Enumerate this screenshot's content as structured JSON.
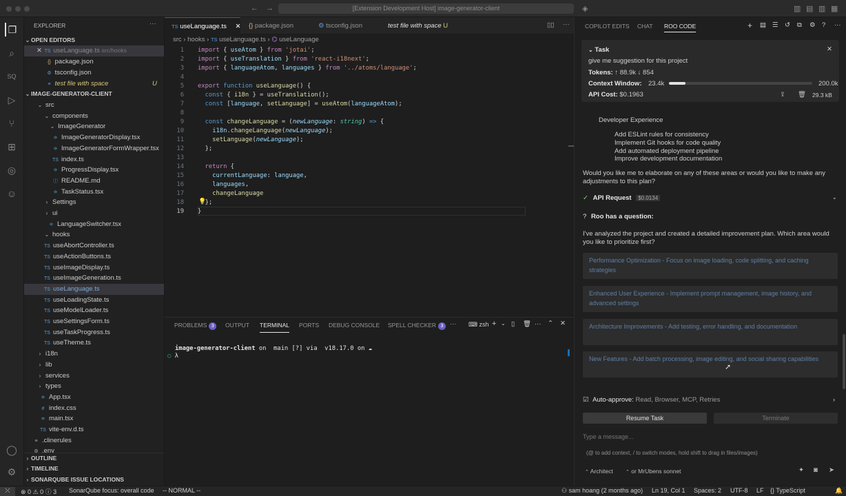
{
  "window_title": "[Extension Development Host] image-generator-client",
  "explorer": {
    "title": "EXPLORER",
    "open_editors_label": "OPEN EDITORS",
    "open_editors": [
      {
        "name": "useLanguage.ts",
        "path": "src/hooks"
      },
      {
        "name": "package.json"
      },
      {
        "name": "tsconfig.json"
      },
      {
        "name": "test file with space",
        "status": "U"
      }
    ],
    "project_label": "IMAGE-GENERATOR-CLIENT",
    "tree": [
      "src",
      "components",
      "ImageGenerator",
      "ImageGeneratorDisplay.tsx",
      "ImageGeneratorFormWrapper.tsx",
      "index.ts",
      "ProgressDisplay.tsx",
      "README.md",
      "TaskStatus.tsx",
      "Settings",
      "ui",
      "LanguageSwitcher.tsx",
      "hooks",
      "useAbortController.ts",
      "useActionButtons.ts",
      "useImageDisplay.ts",
      "useImageGeneration.ts",
      "useLanguage.ts",
      "useLoadingState.ts",
      "useModelLoader.ts",
      "useSettingsForm.ts",
      "useTaskProgress.ts",
      "useTheme.ts",
      "i18n",
      "lib",
      "services",
      "types",
      "App.tsx",
      "index.css",
      "main.tsx",
      "vite-env.d.ts",
      ".clinerules",
      ".env"
    ],
    "outline": "OUTLINE",
    "timeline": "TIMELINE",
    "sonarqube": "SONARQUBE ISSUE LOCATIONS"
  },
  "editor": {
    "tabs": [
      "useLanguage.ts",
      "package.json",
      "tsconfig.json",
      "test file with space"
    ],
    "tab_status": "U",
    "breadcrumbs": [
      "src",
      "hooks",
      "useLanguage.ts",
      "useLanguage"
    ],
    "line_numbers": [
      "1",
      "2",
      "3",
      "4",
      "5",
      "6",
      "7",
      "8",
      "9",
      "10",
      "11",
      "12",
      "13",
      "14",
      "15",
      "16",
      "17",
      "18",
      "19"
    ]
  },
  "panel": {
    "tabs": [
      "PROBLEMS",
      "OUTPUT",
      "TERMINAL",
      "PORTS",
      "DEBUG CONSOLE",
      "SPELL CHECKER"
    ],
    "problems_count": "3",
    "spell_count": "3",
    "shell": "zsh",
    "prompt_dir": "image-generator-client",
    "prompt_rest": " on  main [?] via  v18.17.0 on ☁",
    "prompt_lambda": "λ"
  },
  "roo": {
    "tabs": [
      "COPILOT EDITS",
      "CHAT",
      "ROO CODE"
    ],
    "task_label": "Task",
    "task_text": "give me suggestion for this project",
    "tokens_label": "Tokens:",
    "tokens_up": "↑ 88.9k",
    "tokens_down": "↓ 854",
    "context_label": "Context Window:",
    "context_used": "23.4k",
    "context_max": "200.0k",
    "context_fraction": 0.117,
    "cost_label": "API Cost:",
    "cost": "$0.1963",
    "size": "29.3 kB",
    "dev_exp": "Developer Experience",
    "dev_items": [
      "Add ESLint rules for consistency",
      "Implement Git hooks for code quality",
      "Add automated deployment pipeline",
      "Improve development documentation"
    ],
    "elaborate": "Would you like me to elaborate on any of these areas or would you like to make any adjustments to this plan?",
    "api_request": "API Request",
    "api_cost": "$0.0134",
    "question_label": "Roo has a question:",
    "question_text": "I've analyzed the project and created a detailed improvement plan. Which area would you like to prioritize first?",
    "options": [
      "Performance Optimization - Focus on image loading, code splitting, and caching strategies",
      "Enhanced User Experience - Implement prompt management, image history, and advanced settings",
      "Architecture Improvements - Add testing, error handling, and documentation",
      "New Features - Add batch processing, image editing, and social sharing capabilities"
    ],
    "auto_approve_label": "Auto-approve:",
    "auto_approve_items": "Read, Browser, MCP, Retries",
    "resume": "Resume Task",
    "terminate": "Terminate",
    "input_placeholder": "Type a message...",
    "hint": "(@ to add context, / to switch modes, hold shift to drag in files/images)",
    "mode": "Architect",
    "model": "or MrUbens sonnet"
  },
  "status": {
    "errors": "0",
    "warnings": "0",
    "info": "3",
    "sonar": "SonarQube focus: overall code",
    "vim": "-- NORMAL --",
    "blame": "sam hoang (2 months ago)",
    "position": "Ln 19, Col 1",
    "spaces": "Spaces: 2",
    "encoding": "UTF-8",
    "eol": "LF",
    "language": "TypeScript"
  },
  "colors": {
    "accent": "#0e70c0",
    "badge": "#6c5fc7",
    "option_text": "#5e7fa8"
  }
}
